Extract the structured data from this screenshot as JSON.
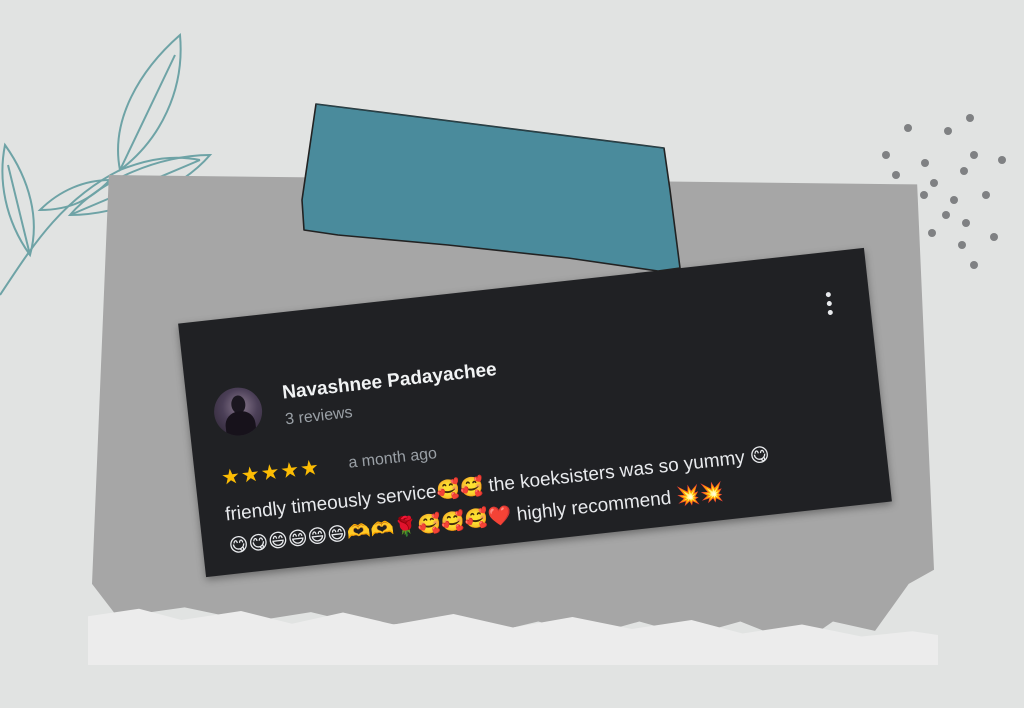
{
  "review": {
    "author": "Navashnee Padayachee",
    "reviews_count": "3 reviews",
    "stars": "★★★★★",
    "rating": 5,
    "time": "a month ago",
    "text": "friendly timeously service🥰🥰 the koeksisters was so yummy 😋😋😋😄😄😄😄🫶🫶🌹🥰🥰🥰❤️ highly recommend 💥💥"
  },
  "icons": {
    "menu": "more-vert-icon",
    "avatar": "avatar",
    "decor_leaf": "leaf-branch-icon",
    "decor_dots": "dots-pattern-icon",
    "tape": "tape-strip"
  },
  "colors": {
    "card_bg": "#202124",
    "star": "#fbbc04",
    "tape": "#4a8b9c",
    "paper": "#a6a6a6",
    "background": "#e1e3e2"
  }
}
